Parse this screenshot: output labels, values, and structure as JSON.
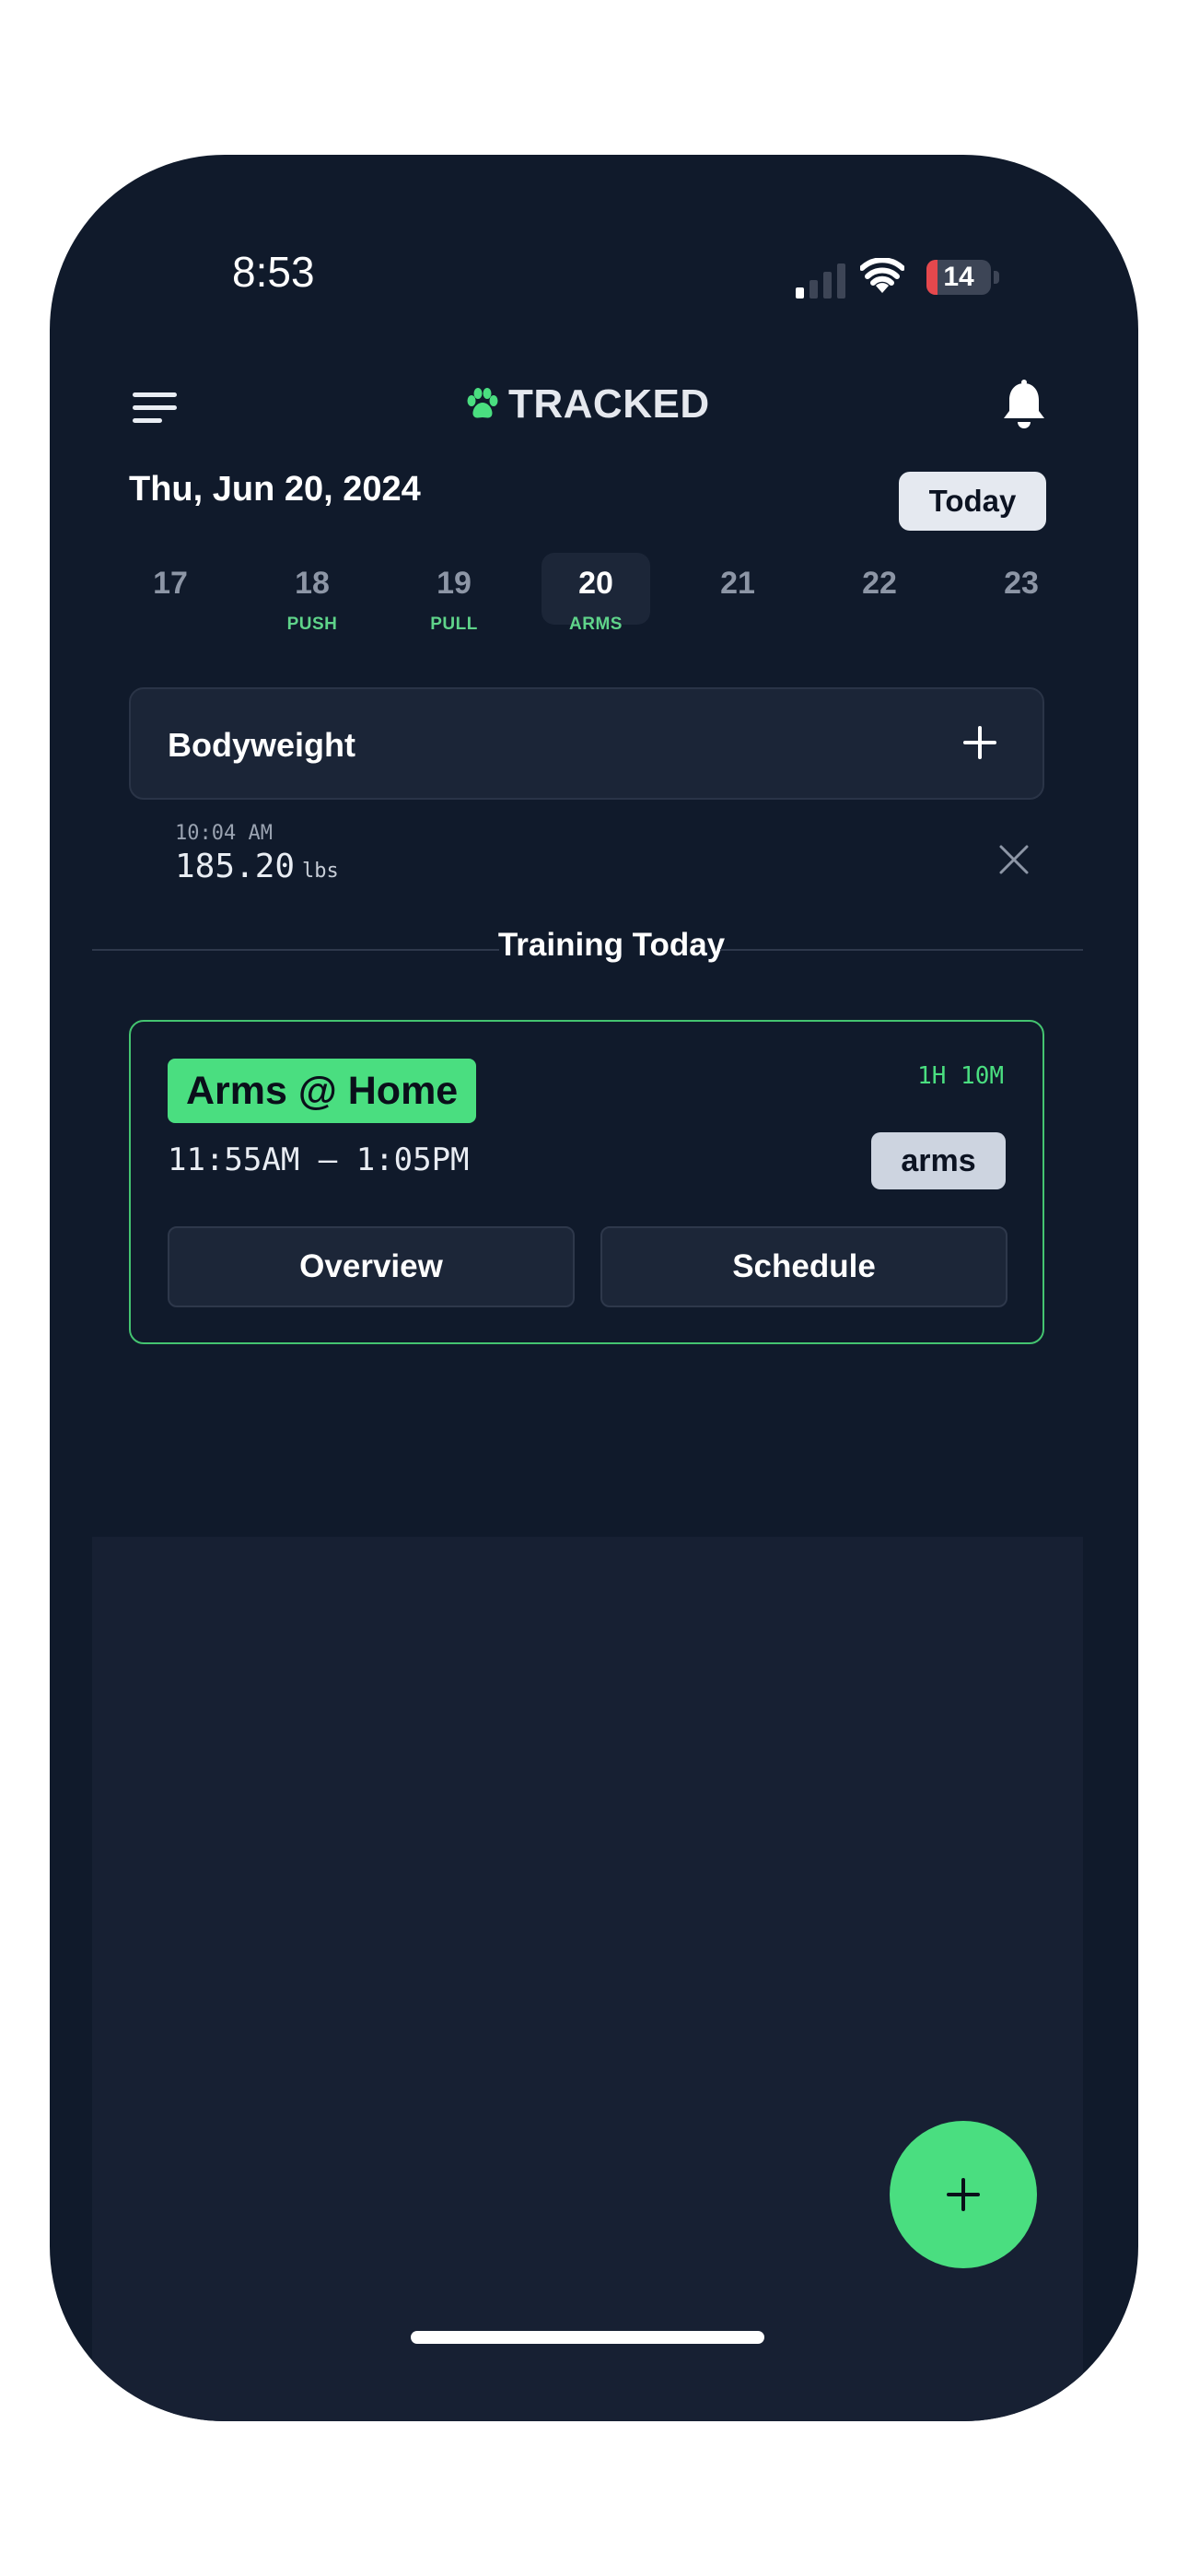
{
  "status_bar": {
    "time": "8:53",
    "battery": "14",
    "signal_icon": "cellular-signal-icon",
    "wifi_icon": "wifi-icon"
  },
  "header": {
    "brand": "TRACKED",
    "menu_icon": "menu-icon",
    "logo_icon": "paw-icon",
    "notification_icon": "bell-icon"
  },
  "date_selector": {
    "current_date": "Thu, Jun 20, 2024",
    "today_button": "Today",
    "days": [
      {
        "num": "17",
        "tag": ""
      },
      {
        "num": "18",
        "tag": "PUSH"
      },
      {
        "num": "19",
        "tag": "PULL"
      },
      {
        "num": "20",
        "tag": "ARMS",
        "selected": true
      },
      {
        "num": "21",
        "tag": ""
      },
      {
        "num": "22",
        "tag": ""
      },
      {
        "num": "23",
        "tag": ""
      }
    ]
  },
  "bodyweight": {
    "label": "Bodyweight",
    "entry_time": "10:04 AM",
    "entry_value": "185.20",
    "entry_unit": "lbs"
  },
  "training": {
    "section_title": "Training Today",
    "workout": {
      "name": "Arms @ Home",
      "duration": "1H 10M",
      "time_range": "11:55AM – 1:05PM",
      "tag": "arms",
      "overview_button": "Overview",
      "schedule_button": "Schedule"
    }
  },
  "colors": {
    "background": "#101a2b",
    "accent": "#4ade80",
    "card": "#1b2537"
  }
}
